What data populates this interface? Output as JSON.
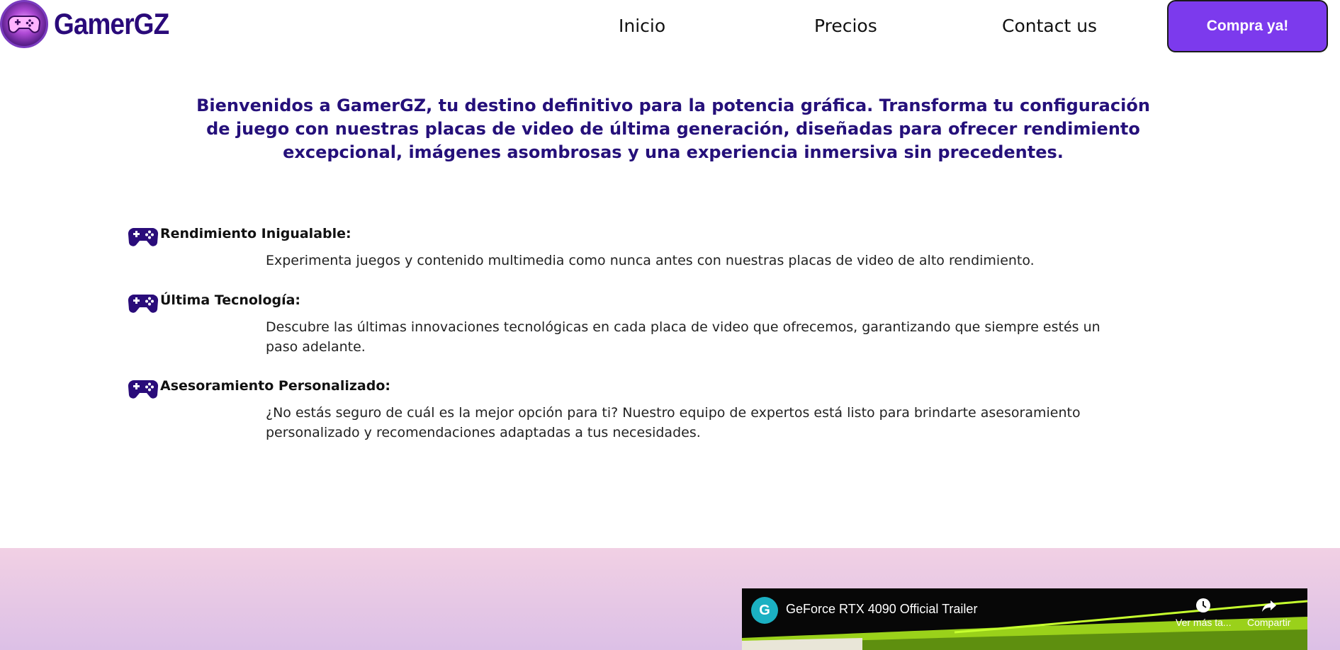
{
  "header": {
    "logo_text": "GamerGZ",
    "nav": [
      "Inicio",
      "Precios",
      "Contact us"
    ],
    "cta_label": "Compra ya!"
  },
  "intro": {
    "text": "Bienvenidos a GamerGZ, tu destino definitivo para la potencia gráfica. Transforma tu configuración de juego con nuestras placas de video de última generación, diseñadas para ofrecer rendimiento excepcional, imágenes asombrosas y una experiencia inmersiva sin precedentes."
  },
  "features": [
    {
      "title": "Rendimiento Inigualable:",
      "description": "Experimenta juegos y contenido multimedia como nunca antes con nuestras placas de video de alto rendimiento.",
      "icon": "gamepad-icon"
    },
    {
      "title": "Última Tecnología:",
      "description": "Descubre las últimas innovaciones tecnológicas en cada placa de video que ofrecemos, garantizando que siempre estés un paso adelante.",
      "icon": "gamepad-icon"
    },
    {
      "title": "Asesoramiento Personalizado:",
      "description": "¿No estás seguro de cuál es la mejor opción para ti? Nuestro equipo de expertos está listo para brindarte asesoramiento personalizado y recomendaciones adaptadas a tus necesidades.",
      "icon": "gamepad-icon"
    }
  ],
  "video": {
    "channel_initial": "G",
    "title": "GeForce RTX 4090 Official Trailer",
    "watch_later_label": "Ver más ta...",
    "share_label": "Compartir"
  },
  "colors": {
    "brand": "#25107a",
    "accent": "#7c3aed",
    "band_top": "#f1d0e4",
    "band_bottom": "#dcc0e6"
  }
}
